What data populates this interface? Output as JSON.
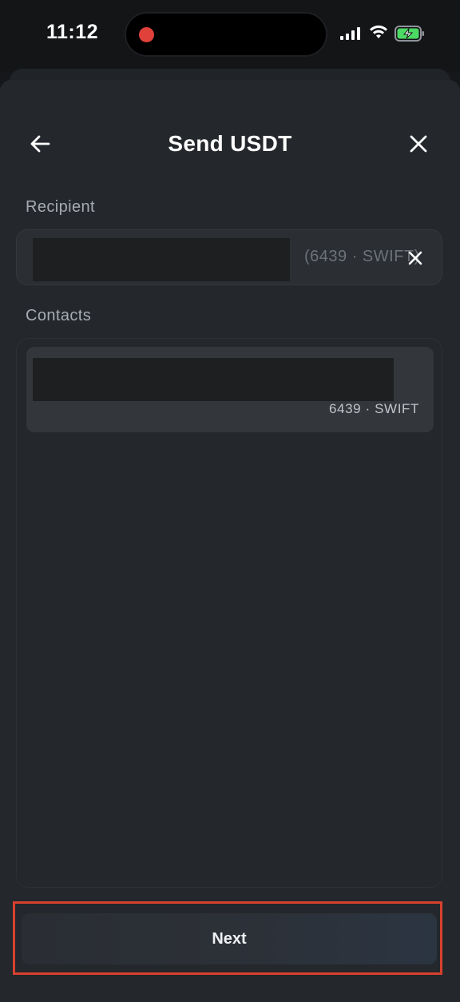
{
  "status_bar": {
    "time": "11:12",
    "battery_icon": "battery-charging-icon",
    "wifi_icon": "wifi-icon",
    "signal_icon": "cellular-signal-icon",
    "recording_color": "#e0413a",
    "battery_color": "#4cd964"
  },
  "header": {
    "title": "Send USDT",
    "back_icon": "arrow-left-icon",
    "close_icon": "close-icon"
  },
  "recipient": {
    "label": "Recipient",
    "value_tail": "(6439 · SWIFT)",
    "clear_icon": "close-icon"
  },
  "contacts": {
    "label": "Contacts",
    "items": [
      {
        "subtitle": "6439 · SWIFT"
      }
    ]
  },
  "footer": {
    "next_label": "Next",
    "highlight_color": "#d8402f"
  }
}
